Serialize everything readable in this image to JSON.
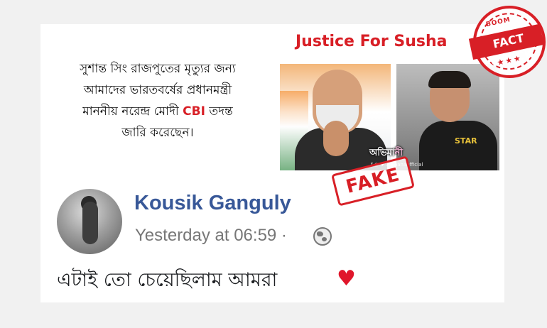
{
  "banner": {
    "title": "Justice For Susha"
  },
  "caption": {
    "line1": "সুশান্ত সিং রাজপুতের মৃত্যুর জন্য",
    "line2": "আমাদের ভারতবর্ষের প্রধানমন্ত্রী",
    "line3_before": "মাননীয় নরেন্দ্র মোদী ",
    "line3_highlight": "CBI",
    "line3_after": " তদন্ত",
    "line4": "জারি করেছেন।"
  },
  "photo": {
    "label_main": "অভিমা",
    "label_accent": "নী",
    "handle": "f ◎ ♥ ... manaofficial",
    "tee_text": "STAR"
  },
  "stamps": {
    "fake": "FAKE",
    "badge_top": "BOOM",
    "badge_main": "FACT CHECK",
    "badge_stars": "★★★"
  },
  "post": {
    "author": "Kousik Ganguly",
    "timestamp": "Yesterday at 06:59 ·",
    "text": "এটাই তো চেয়েছিলাম আমরা",
    "heart": "♥"
  },
  "colors": {
    "accent_red": "#d81f26",
    "fb_blue": "#385898"
  },
  "icons": [
    "globe-icon",
    "heart-icon"
  ]
}
